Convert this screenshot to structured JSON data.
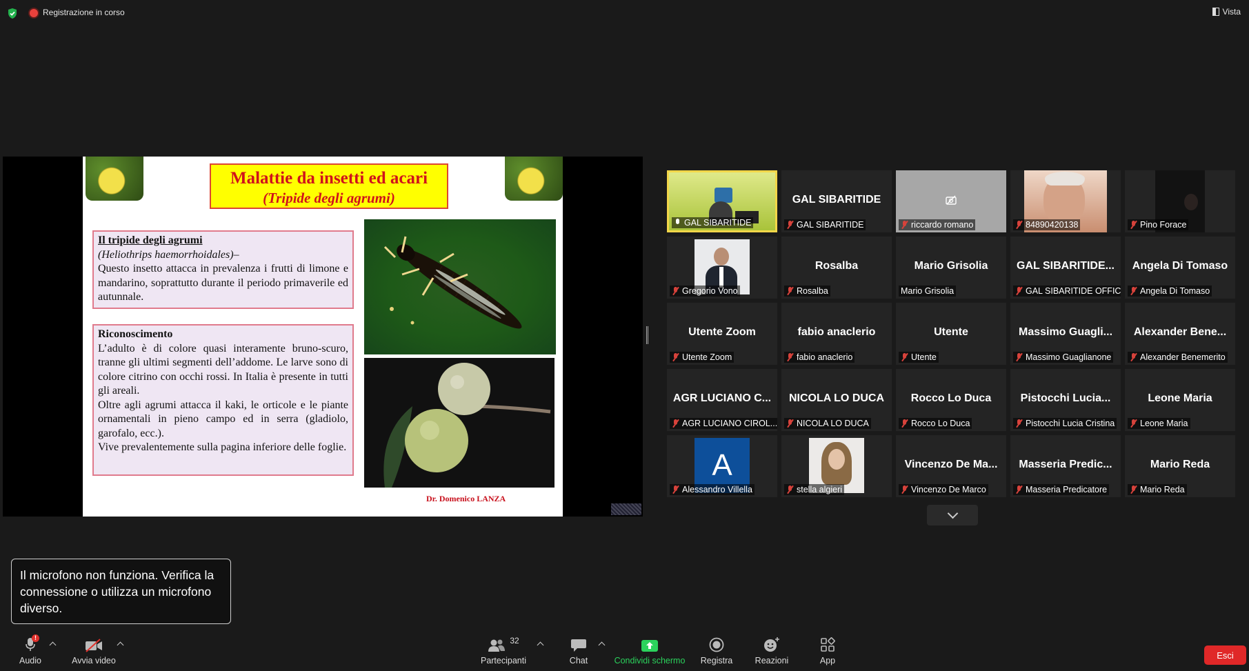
{
  "topbar": {
    "recording": "Registrazione in corso",
    "view": "Vista"
  },
  "slide": {
    "title": "Malattie da insetti ed acari",
    "subtitle": "(Tripide degli agrumi)",
    "box1": {
      "heading": "Il tripide degli agrumi",
      "species": "(Heliothrips haemorrhoidales)–",
      "text": "Questo insetto attacca in prevalenza i frutti di limone e mandarino, soprattutto durante il periodo primaverile ed autunnale."
    },
    "box2": {
      "heading": "Riconoscimento",
      "p1": "L’adulto è di colore quasi interamente bruno-scuro, tranne gli ultimi segmenti dell’addome. Le larve sono di colore citrino con occhi rossi. In Italia è presente in tutti gli areali.",
      "p2": "Oltre agli agrumi attacca il kaki, le orticole e le piante ornamentali in pieno campo ed in serra (gladiolo, garofalo, ecc.).",
      "p3": "Vive prevalentemente sulla pagina inferiore delle foglie."
    },
    "credit": "Dr. Domenico LANZA"
  },
  "participants": [
    {
      "center": "",
      "label": "GAL SIBARITIDE",
      "mic": "on",
      "video": "office"
    },
    {
      "center": "GAL SIBARITIDE",
      "label": "GAL SIBARITIDE",
      "mic": "off",
      "video": ""
    },
    {
      "center": "",
      "label": "riccardo romano",
      "mic": "off",
      "video": "camera-off"
    },
    {
      "center": "",
      "label": "84890420138",
      "mic": "off",
      "video": "face"
    },
    {
      "center": "",
      "label": "Pino Forace",
      "mic": "off",
      "video": "dark"
    },
    {
      "center": "",
      "label": "Gregorio Vono",
      "mic": "off",
      "video": "suit"
    },
    {
      "center": "Rosalba",
      "label": "Rosalba",
      "mic": "off",
      "video": ""
    },
    {
      "center": "Mario Grisolia",
      "label": "Mario Grisolia",
      "mic": "none",
      "video": ""
    },
    {
      "center": "GAL SIBARITIDE...",
      "label": "GAL SIBARITIDE OFFICE",
      "mic": "off",
      "video": ""
    },
    {
      "center": "Angela Di Tomaso",
      "label": "Angela Di Tomaso",
      "mic": "off",
      "video": ""
    },
    {
      "center": "Utente Zoom",
      "label": "Utente Zoom",
      "mic": "off",
      "video": ""
    },
    {
      "center": "fabio anaclerio",
      "label": "fabio anaclerio",
      "mic": "off",
      "video": ""
    },
    {
      "center": "Utente",
      "label": "Utente",
      "mic": "off",
      "video": ""
    },
    {
      "center": "Massimo Guagli...",
      "label": "Massimo Guaglianone",
      "mic": "off",
      "video": ""
    },
    {
      "center": "Alexander Bene...",
      "label": "Alexander Benemerito",
      "mic": "off",
      "video": ""
    },
    {
      "center": "AGR LUCIANO C...",
      "label": "AGR LUCIANO CIROL...",
      "mic": "off",
      "video": ""
    },
    {
      "center": "NICOLA LO DUCA",
      "label": "NICOLA LO DUCA",
      "mic": "off",
      "video": ""
    },
    {
      "center": "Rocco Lo Duca",
      "label": "Rocco Lo Duca",
      "mic": "off",
      "video": ""
    },
    {
      "center": "Pistocchi Lucia...",
      "label": "Pistocchi Lucia Cristina",
      "mic": "off",
      "video": ""
    },
    {
      "center": "Leone Maria",
      "label": "Leone Maria",
      "mic": "off",
      "video": ""
    },
    {
      "center": "",
      "label": "Alessandro Villella",
      "mic": "off",
      "video": "avatar-A"
    },
    {
      "center": "",
      "label": "stella algieri",
      "mic": "off",
      "video": "woman"
    },
    {
      "center": "Vincenzo De Ma...",
      "label": "Vincenzo De Marco",
      "mic": "off",
      "video": ""
    },
    {
      "center": "Masseria Predic...",
      "label": "Masseria Predicatore",
      "mic": "off",
      "video": ""
    },
    {
      "center": "Mario Reda",
      "label": "Mario Reda",
      "mic": "off",
      "video": ""
    }
  ],
  "avatar_letter": "A",
  "toast": "Il microfono non funziona. Verifica la connessione o utilizza un microfono diverso.",
  "toolbar": {
    "audio": "Audio",
    "video": "Avvia video",
    "participants": "Partecipanti",
    "participants_count": "32",
    "chat": "Chat",
    "share": "Condividi schermo",
    "record": "Registra",
    "reactions": "Reazioni",
    "apps": "App",
    "exit": "Esci"
  },
  "colors": {
    "share_green": "#2bd25c",
    "exit_red": "#e02828",
    "active_border": "#f2d649",
    "mic_muted": "#d7423b"
  }
}
